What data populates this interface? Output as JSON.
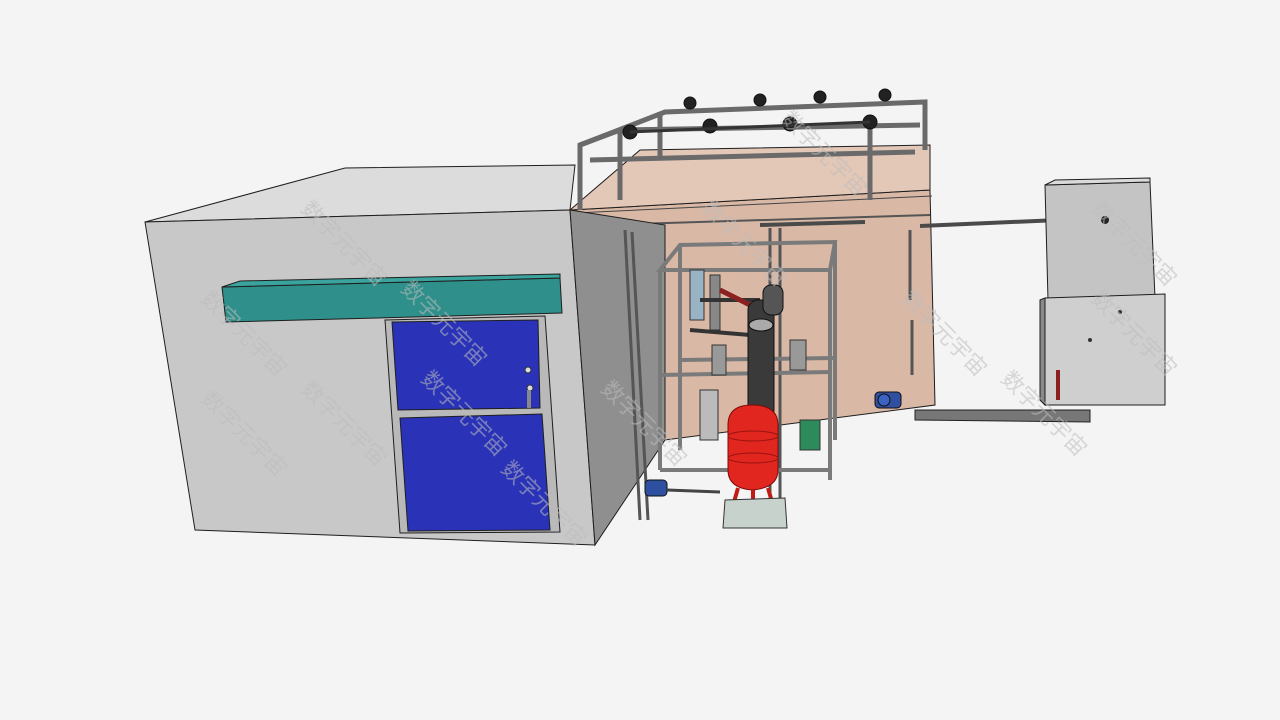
{
  "scene": {
    "watermark_text": "数字元宇宙",
    "colors": {
      "background": "#f4f4f4",
      "cleanroom_front": "#c8c8c8",
      "cleanroom_top": "#dcdcdc",
      "cleanroom_side": "#8f8f8f",
      "door_panel": "#2a33b8",
      "door_frame": "#b9b9b9",
      "air_shower_header": "#2f8f8a",
      "tank_room": "#d9b8a6",
      "tank_room_side": "#c9a48f",
      "frame_steel": "#9a9a9a",
      "pressure_tank": "#e0261f",
      "filter_column": "#3a3a3a",
      "cabinet": "#c4c4c4",
      "pump": "#2f4fa0",
      "outline": "#1e1e1e"
    }
  }
}
